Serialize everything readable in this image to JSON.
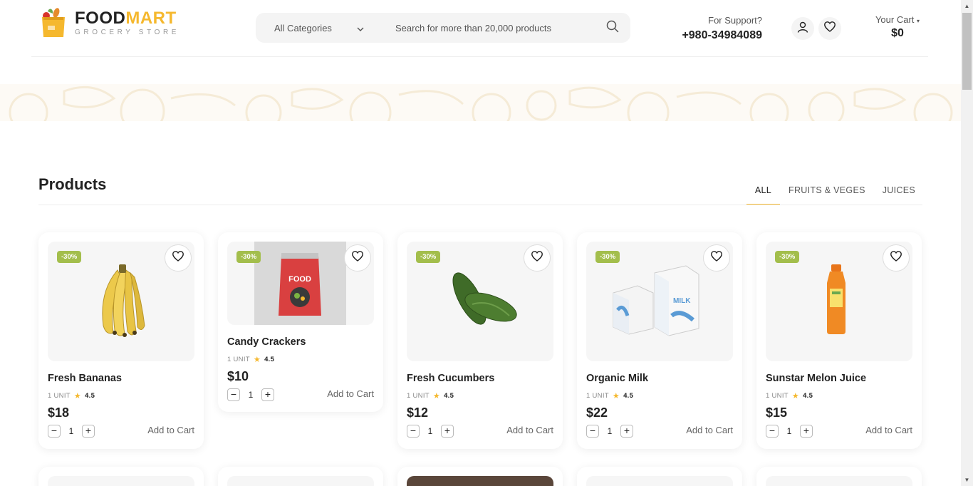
{
  "header": {
    "logo_main_a": "FOOD",
    "logo_main_b": "MART",
    "logo_sub": "GROCERY STORE",
    "category_label": "All Categories",
    "search_placeholder": "Search for more than 20,000 products",
    "support_label": "For Support?",
    "support_phone": "+980-34984089",
    "cart_label": "Your Cart",
    "cart_total": "$0"
  },
  "products": {
    "title": "Products",
    "tabs": [
      {
        "label": "ALL",
        "active": true
      },
      {
        "label": "FRUITS & VEGES",
        "active": false
      },
      {
        "label": "JUICES",
        "active": false
      }
    ],
    "items": [
      {
        "name": "Fresh Bananas",
        "badge": "-30%",
        "unit": "1 UNIT",
        "rating": "4.5",
        "price": "$18",
        "qty": "1",
        "add_label": "Add to Cart",
        "image": "banana"
      },
      {
        "name": "Candy Crackers",
        "badge": "-30%",
        "unit": "1 UNIT",
        "rating": "4.5",
        "price": "$10",
        "qty": "1",
        "add_label": "Add to Cart",
        "image": "snack-bag",
        "bag_text": "FOOD"
      },
      {
        "name": "Fresh Cucumbers",
        "badge": "-30%",
        "unit": "1 UNIT",
        "rating": "4.5",
        "price": "$12",
        "qty": "1",
        "add_label": "Add to Cart",
        "image": "cucumber"
      },
      {
        "name": "Organic Milk",
        "badge": "-30%",
        "unit": "1 UNIT",
        "rating": "4.5",
        "price": "$22",
        "qty": "1",
        "add_label": "Add to Cart",
        "image": "milk-cartons",
        "carton_text": "MILK"
      },
      {
        "name": "Sunstar Melon Juice",
        "badge": "-30%",
        "unit": "1 UNIT",
        "rating": "4.5",
        "price": "$15",
        "qty": "1",
        "add_label": "Add to Cart",
        "image": "juice-bottle"
      }
    ]
  },
  "colors": {
    "accent": "#f5b82e",
    "badge": "#a3be4c"
  }
}
